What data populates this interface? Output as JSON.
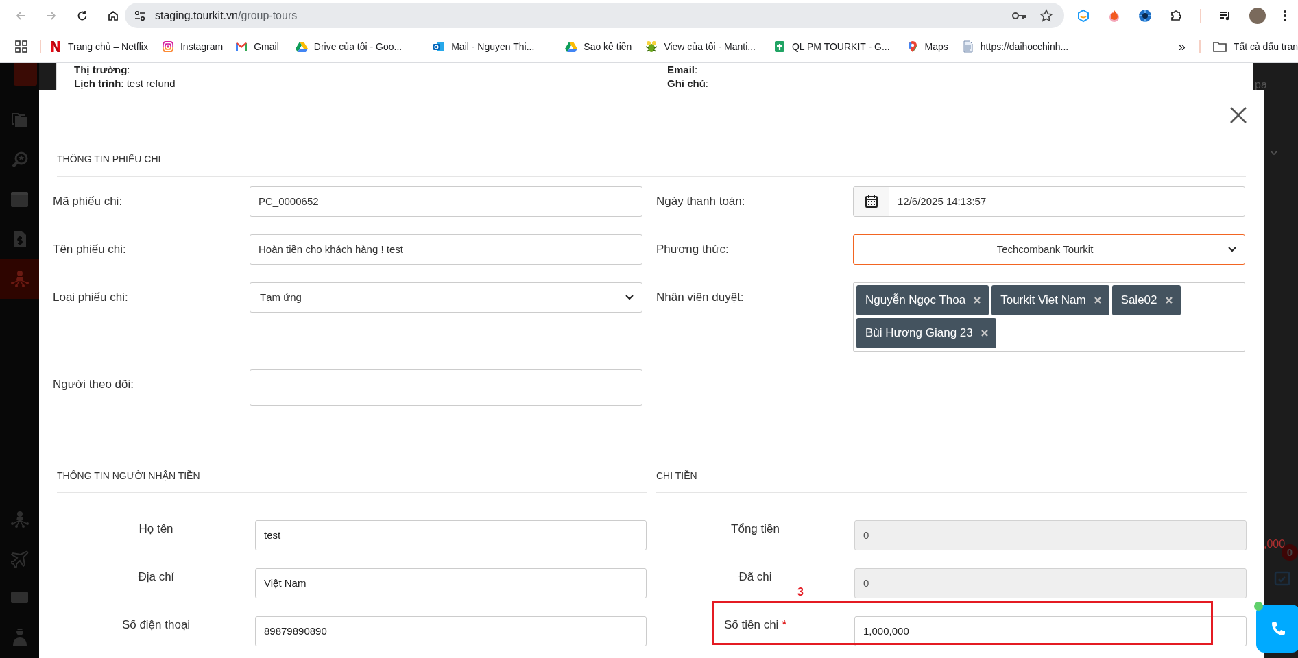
{
  "browser": {
    "url_host": "staging.tourkit.vn",
    "url_path": "/group-tours",
    "bookmarks": [
      {
        "label": "Trang chủ – Netflix"
      },
      {
        "label": "Instagram"
      },
      {
        "label": "Gmail"
      },
      {
        "label": "Drive của tôi - Goo..."
      },
      {
        "label": "Mail - Nguyen Thi..."
      },
      {
        "label": "Sao kê tiền"
      },
      {
        "label": "View của tôi - Manti..."
      },
      {
        "label": "QL PM TOURKIT - G..."
      },
      {
        "label": "Maps"
      },
      {
        "label": "https://daihocchinh..."
      }
    ],
    "more": "»",
    "all_bookmarks": "Tất cả dấu tran"
  },
  "sidebar": {
    "top_items": [
      {
        "kind": "folders",
        "selected": false
      },
      {
        "kind": "search",
        "selected": false
      },
      {
        "kind": "calendar",
        "selected": false
      },
      {
        "kind": "invoice",
        "selected": false
      },
      {
        "kind": "network",
        "selected": true
      }
    ],
    "bottom_items": [
      {
        "kind": "network",
        "selected": false
      },
      {
        "kind": "plane",
        "selected": false
      },
      {
        "kind": "card",
        "selected": false
      },
      {
        "kind": "person",
        "selected": false
      }
    ]
  },
  "background": {
    "left": [
      "**Thị trường**:",
      "**Lịch trình**: test refund"
    ],
    "right": [
      "**Email**:",
      "**Ghi chú**:"
    ],
    "select_fragment": "pa",
    "amount_fragment": ",000",
    "badge": "0"
  },
  "modal": {
    "payment_info": {
      "title": "THÔNG TIN PHIẾU CHI",
      "left_fields": [
        {
          "label": "Mã phiếu chi:",
          "kind": "text",
          "value": "PC_0000652"
        },
        {
          "label": "Tên phiếu chi:",
          "kind": "text",
          "value": "Hoàn tiền cho khách hàng ! test"
        },
        {
          "label": "Loại phiếu chi:",
          "kind": "select",
          "value": "Tạm ứng",
          "focused": false
        },
        {
          "label": "Người theo dõi:",
          "kind": "textarea"
        }
      ],
      "right_fields": [
        {
          "label": "Ngày thanh toán:",
          "kind": "date",
          "value": "12/6/2025 14:13:57"
        },
        {
          "label": "Phương thức:",
          "kind": "select",
          "value": "Techcombank Tourkit",
          "focused": true
        },
        {
          "label": "Nhân viên duyệt:",
          "kind": "tags",
          "tags": [
            "Nguyễn Ngọc Thoa",
            "Tourkit Viet Nam",
            "Sale02",
            "Bùi Hương Giang 23"
          ]
        }
      ]
    },
    "recipient": {
      "title": "THÔNG TIN NGƯỜI NHẬN TIỀN",
      "fields": [
        {
          "label": "Họ tên",
          "value": "test"
        },
        {
          "label": "Địa chỉ",
          "value": "Việt Nam"
        },
        {
          "label": "Số điện thoại",
          "value": "89879890890"
        }
      ]
    },
    "payment": {
      "title": "CHI TIỀN",
      "fields": [
        {
          "label": "Tổng tiền",
          "value": "0",
          "readonly": true
        },
        {
          "label": "Đã chi",
          "value": "0",
          "readonly": true
        },
        {
          "label": "Số tiền chi",
          "value": "1,000,000",
          "readonly": false,
          "required_mark": "*"
        }
      ]
    },
    "annotation": {
      "label": "3"
    }
  }
}
